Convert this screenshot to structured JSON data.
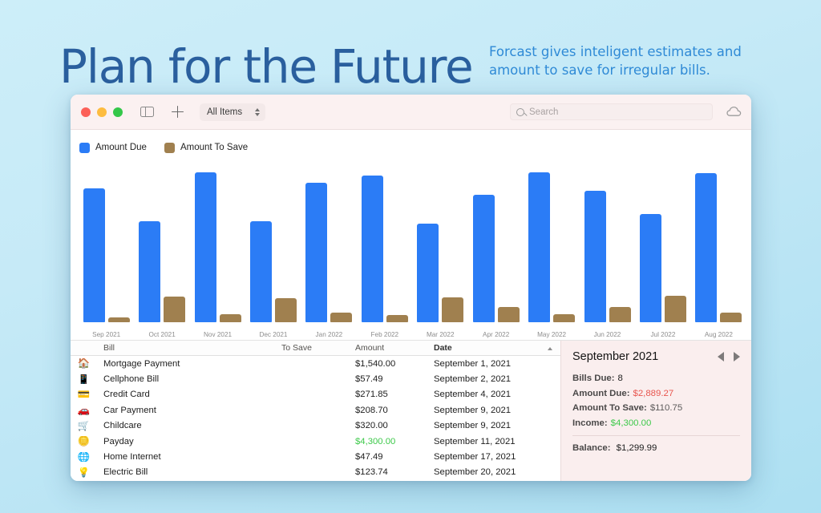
{
  "hero": {
    "title": "Plan for the Future",
    "subtitle": "Forcast gives inteligent estimates and amount to save for irregular bills."
  },
  "colors": {
    "amount_due": "#2b7cf6",
    "amount_to_save": "#a0804f",
    "income_green": "#3dc94a",
    "due_red": "#e8554e",
    "title_blue": "#2a5f9e",
    "subtitle_blue": "#2f8ad6",
    "background_top": "#cdeef9",
    "background_bottom": "#ade0f2"
  },
  "toolbar": {
    "traffic_lights": [
      "close",
      "minimize",
      "zoom"
    ],
    "sidebar_toggle_icon": "sidebar-icon",
    "add_icon": "plus-icon",
    "filter_label": "All Items",
    "search_placeholder": "Search",
    "search_value": "",
    "search_icon": "search-icon",
    "cloud_icon": "cloud-icon"
  },
  "legend": [
    {
      "label": "Amount Due",
      "color": "#2b7cf6"
    },
    {
      "label": "Amount To Save",
      "color": "#a0804f"
    }
  ],
  "chart_data": {
    "type": "bar",
    "title": "",
    "xlabel": "",
    "ylabel": "",
    "grid": false,
    "legend_position": "top-left",
    "ylim": [
      0,
      3400
    ],
    "categories": [
      "Sep 2021",
      "Oct 2021",
      "Nov 2021",
      "Dec 2021",
      "Jan 2022",
      "Feb 2022",
      "Mar 2022",
      "Apr 2022",
      "May 2022",
      "Jun 2022",
      "Jul 2022",
      "Aug 2022"
    ],
    "series": [
      {
        "name": "Amount Due",
        "color": "#2b7cf6",
        "values": [
          2889,
          2180,
          3240,
          2180,
          3020,
          3170,
          2130,
          2760,
          3250,
          2840,
          2340,
          3230
        ]
      },
      {
        "name": "Amount To Save",
        "color": "#a0804f",
        "values": [
          111,
          560,
          180,
          520,
          200,
          160,
          540,
          330,
          175,
          330,
          580,
          210
        ]
      }
    ]
  },
  "table": {
    "columns": [
      {
        "key": "icon",
        "label": "",
        "sorted": false
      },
      {
        "key": "bill",
        "label": "Bill",
        "sorted": false
      },
      {
        "key": "to_save",
        "label": "To Save",
        "sorted": false
      },
      {
        "key": "amount",
        "label": "Amount",
        "sorted": false
      },
      {
        "key": "date",
        "label": "Date",
        "sorted": true,
        "direction": "ascending"
      }
    ],
    "rows": [
      {
        "icon": "house-icon",
        "glyph": "🏠",
        "bill": "Mortgage Payment",
        "to_save": "",
        "amount": "$1,540.00",
        "income": false,
        "date": "September 1, 2021"
      },
      {
        "icon": "mobile-phone-icon",
        "glyph": "📱",
        "bill": "Cellphone Bill",
        "to_save": "",
        "amount": "$57.49",
        "income": false,
        "date": "September 2, 2021"
      },
      {
        "icon": "credit-card-icon",
        "glyph": "💳",
        "bill": "Credit Card",
        "to_save": "",
        "amount": "$271.85",
        "income": false,
        "date": "September 4, 2021"
      },
      {
        "icon": "car-icon",
        "glyph": "🚗",
        "bill": "Car Payment",
        "to_save": "",
        "amount": "$208.70",
        "income": false,
        "date": "September 9, 2021"
      },
      {
        "icon": "stroller-icon",
        "glyph": "🛒",
        "bill": "Childcare",
        "to_save": "",
        "amount": "$320.00",
        "income": false,
        "date": "September 9, 2021"
      },
      {
        "icon": "coin-icon",
        "glyph": "🪙",
        "bill": "Payday",
        "to_save": "",
        "amount": "$4,300.00",
        "income": true,
        "date": "September 11, 2021"
      },
      {
        "icon": "globe-icon",
        "glyph": "🌐",
        "bill": "Home Internet",
        "to_save": "",
        "amount": "$47.49",
        "income": false,
        "date": "September 17, 2021"
      },
      {
        "icon": "lightbulb-icon",
        "glyph": "💡",
        "bill": "Electric Bill",
        "to_save": "",
        "amount": "$123.74",
        "income": false,
        "date": "September 20, 2021"
      }
    ]
  },
  "detail": {
    "title": "September 2021",
    "prev_icon": "triangle-left-icon",
    "next_icon": "triangle-right-icon",
    "stats": [
      {
        "label": "Bills Due:",
        "value": "8",
        "style": "plain"
      },
      {
        "label": "Amount Due:",
        "value": "$2,889.27",
        "style": "due"
      },
      {
        "label": "Amount To Save:",
        "value": "$110.75",
        "style": "save"
      },
      {
        "label": "Income:",
        "value": "$4,300.00",
        "style": "income"
      }
    ],
    "balance": {
      "label": "Balance:",
      "value": "$1,299.99"
    }
  }
}
